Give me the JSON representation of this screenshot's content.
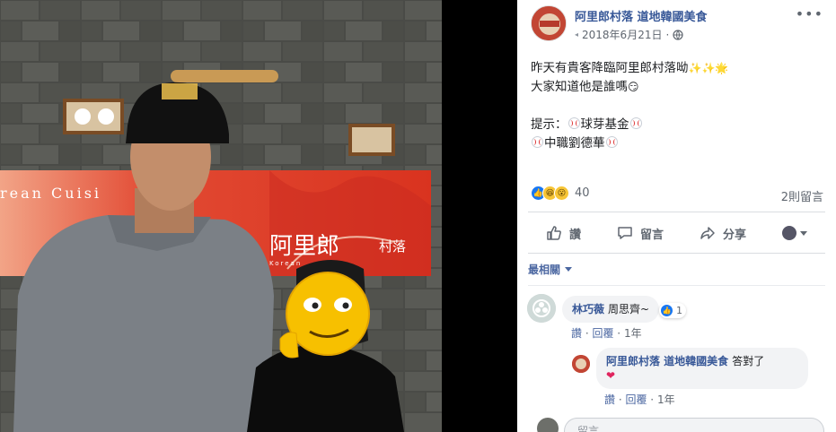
{
  "photo": {
    "sign": {
      "cuisine_text": "rean  Cuisi",
      "brand_text": "阿里郎",
      "village_text": "村落",
      "small_text": "Korean"
    }
  },
  "post": {
    "page_name": "阿里郎村落 道地韓國美食",
    "date": "2018年6月21日",
    "more_label": "•••",
    "lines": [
      "昨天有貴客降臨阿里郎村落呦",
      "大家知道他是誰嗎",
      "提示：",
      "球芽基金",
      "中職劉德華"
    ],
    "reaction_count": "40",
    "comment_count": "2則留言",
    "actions": {
      "like": "讚",
      "comment": "留言",
      "share": "分享"
    },
    "sort_label": "最相關"
  },
  "comments": [
    {
      "author": "林巧薇",
      "text": "周思齊~",
      "reactions": "1",
      "like_link": "讚",
      "reply_link": "回覆",
      "age": "1年"
    },
    {
      "author": "阿里郎村落 道地韓國美食",
      "text": "答對了",
      "like_link": "讚",
      "reply_link": "回覆",
      "age": "1年"
    }
  ],
  "composer": {
    "placeholder": "留言……"
  },
  "colors": {
    "link": "#385898",
    "like_blue": "#1877f2",
    "muted": "#606770",
    "sign_red": "#c92a1f"
  }
}
